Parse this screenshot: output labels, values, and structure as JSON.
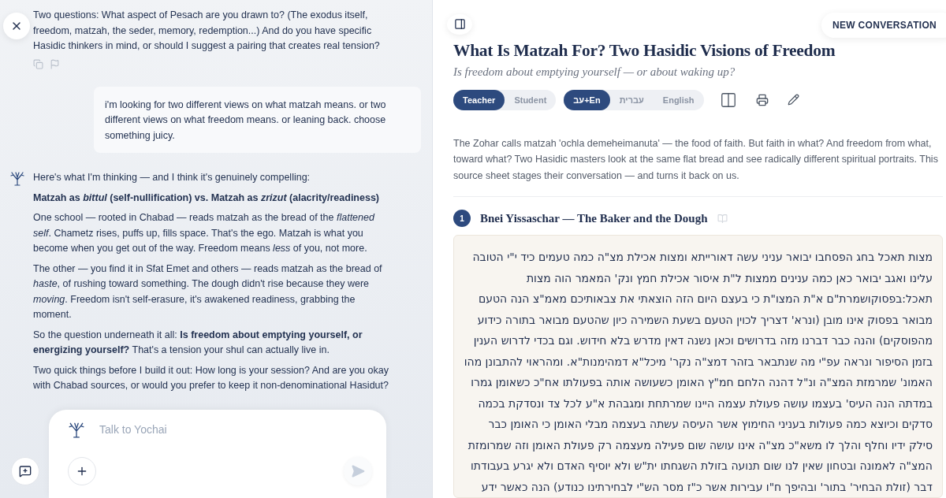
{
  "chat": {
    "messages": [
      {
        "kind": "assistant",
        "avatar": false,
        "actions": true,
        "paragraphs": [
          {
            "kind": "body",
            "text": "Two questions: What aspect of Pesach are you drawn to? (The exodus itself, freedom, matzah, the seder, memory, redemption...) And do you have specific Hasidic thinkers in mind, or should I suggest a pairing that creates real tension?"
          }
        ]
      },
      {
        "kind": "user",
        "avatar": false,
        "actions": false,
        "paragraphs": [
          {
            "kind": "body",
            "text": "i'm looking for two different views on what matzah means. or two different views on what freedom means. or leaning back. choose something juicy."
          }
        ]
      },
      {
        "kind": "assistant",
        "avatar": true,
        "actions": false,
        "paragraphs": [
          {
            "kind": "body",
            "text": "Here's what I'm thinking — and I think it's genuinely compelling:"
          },
          {
            "kind": "heading",
            "text": "Matzah as *bittul* (self-nullification) vs. Matzah as *zrizut* (alacrity/readiness)"
          },
          {
            "kind": "body",
            "text": "One school — rooted in Chabad — reads matzah as the bread of the *flattened self*. Chametz rises, puffs up, fills space. That's the ego. Matzah is what you become when you get out of the way. Freedom means *less* of you, not more."
          },
          {
            "kind": "body",
            "text": "The other — you find it in Sfat Emet and others — reads matzah as the bread of *haste*, of rushing toward something. The dough didn't rise because they were *moving*. Freedom isn't self-erasure, it's awakened readiness, grabbing the moment."
          },
          {
            "kind": "body",
            "text": "So the question underneath it all: **Is freedom about emptying yourself, or energizing yourself?** That's a tension your shul can actually live in."
          },
          {
            "kind": "body",
            "text": "Two quick things before I build it out: How long is your session? And are you okay with Chabad sources, or would you prefer to keep it non-denominational Hasidut?"
          }
        ]
      }
    ],
    "composer": {
      "placeholder": "Talk to Yochai",
      "send_disabled": true
    }
  },
  "new_conversation": "NEW CONVERSATION",
  "sheet": {
    "title": "What Is Matzah For? Two Hasidic Visions of Freedom",
    "subtitle": "Is freedom about emptying yourself — or about waking up?",
    "mode_toggle": [
      {
        "label": "Teacher",
        "selected": true
      },
      {
        "label": "Student",
        "selected": false
      }
    ],
    "language_toggle": [
      {
        "label": "עב+En",
        "selected": true
      },
      {
        "label": "עברית",
        "selected": false
      },
      {
        "label": "English",
        "selected": false
      }
    ],
    "intro": "The Zohar calls matzah 'ochla demeheimanuta' — the food of faith. But faith in what? And freedom from what, toward what? Two Hasidic masters look at the same flat bread and see radically different spiritual portraits. This source sheet stages their conversation — and turns it back on us.",
    "sources": [
      {
        "number": "1",
        "title": "Bnei Yissaschar — The Baker and the Dough",
        "hebrew_lines": [
          "מצות תאכל בחג הפסחבו יבואר עניני עשה דאורייתא ומצות אכילת מצ\"ה כמה טעמים כיד י\"י הטובה",
          "עלינו ואגב יבואר כאן כמה ענינים ממצות ל\"ת איסור אכילת חמץ ונק' המאמר הוה מצות",
          "תאכל:בפסוקושמרת\"ם א\"ת המצו\"ת כי בעצם היום הזה הוצאתי את צבאותיכם מאמ\"צ הנה הטעם",
          "מבואר בפסוק אינו מובן (ונרא' דצריך לכוין הטעם בשעת השמירה כיון שהטעם מבואר בתורה כידוע",
          "מהפוסקים) והנה כבר דברנו מזה בדרושים וכאן נשנה דאין מדרש בלא חידוש. וגם בכדי לדרוש הענין",
          "בזמן הסיפור ונראה עפ\"י מה שנתבאר בזהר דמצ\"ה נקר' מיכל\"א דמהימנות\"א. ומהראוי להתבונן מהו",
          "האמונ' שמרמזת המצ\"ה ונ\"ל דהנה הלחם חמ\"ץ האומן כשעושה אותה בפעולתו אח\"כ כשאומן גמרו",
          "במדתה הנה העיס' בעצמו עושה פעולת עצמה היינו שמרתחת ומגבהת א\"ע לכל צד ונסדקת בכמה",
          "סדקים וכיוצא כמה פעולות בעניני החימוץ אשר העיסה עשתה בעצמה מבלי האומן כי האומן כבר",
          "סילק ידיו וחלף והלך לו משא\"כ מצ\"ה אינו עושה שום פעילה מעצמה רק פעולת האומן וזה שמרומזת",
          "המצ\"ה לאמונה ובטחון שאין לנו שום תנועה בזולת השגחתו ית\"ש ולא יוסיף האדם ולא יגרע בעבודתו",
          "דבר (זולת הבחיר' בתור' ובהיפך ח\"ו עבירות אשר כ\"ז מסר הש\"י לבחירתינו כנודע) הנה כאשר ידע"
        ]
      }
    ]
  }
}
